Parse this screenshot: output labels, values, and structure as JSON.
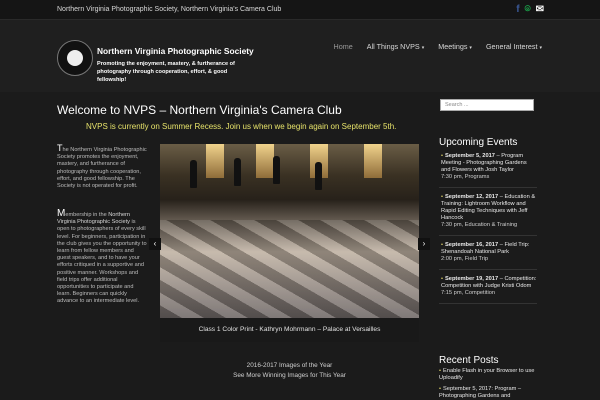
{
  "topbar": {
    "tagline": "Northern Virginia Photographic Society, Northern Virginia's Camera Club",
    "social": [
      {
        "icon": "facebook-icon",
        "symbol": "f",
        "color": "#3b5998"
      },
      {
        "icon": "location-icon",
        "symbol": "⌾",
        "color": "#1aa34a"
      },
      {
        "icon": "mail-icon",
        "symbol": "✉",
        "color": "#ffffff"
      }
    ]
  },
  "header": {
    "site_title": "Northern Virginia Photographic Society",
    "site_desc_1": "Promoting the enjoyment, mastery, & furtherance of",
    "site_desc_2": "photography through cooperation, effort, & good fellowship!",
    "nav": [
      {
        "label": "Home",
        "active": true,
        "has_caret": false
      },
      {
        "label": "All Things NVPS",
        "active": false,
        "has_caret": true
      },
      {
        "label": "Meetings",
        "active": false,
        "has_caret": true
      },
      {
        "label": "General Interest",
        "active": false,
        "has_caret": true
      }
    ]
  },
  "main": {
    "welcome": "Welcome to NVPS – Northern Virginia's Camera Club",
    "recess": "NVPS is currently on Summer Recess. Join us when we begin again on September 5th.",
    "intro_dropcap": "T",
    "intro_text": "he Northern Virginia Photographic Society promotes the enjoyment, mastery, and furtherance of photography through cooperation, effort, and good fellowship. The Society is not operated for profit.",
    "membership_dropcap": "M",
    "membership_text_1": "embership in the ",
    "membership_highlight": "Northern Virginia Photographic Society",
    "membership_text_2": " is open to photographers of every skill level. For beginners, participation in the club gives you the opportunity to learn from fellow members and guest speakers, and to have your efforts critiqued in a supportive and positive manner. Workshops and field trips offer additional opportunities to participate and learn. Beginners can quickly advance to an intermediate level.",
    "slider_caption": "Class 1 Color Print - Kathryn Mohrmann – Palace at Versailles",
    "images_link_1": "2016-2017 Images of the Year",
    "images_link_2": "See More Winning Images for This Year"
  },
  "sidebar": {
    "search_placeholder": "Search ...",
    "upcoming_title": "Upcoming Events",
    "events": [
      {
        "date": "September 5, 2017",
        "title": " – Program Meeting - Photographing Gardens and Flowers with Josh Taylor",
        "meta": "7:30 pm, Programs"
      },
      {
        "date": "September 12, 2017",
        "title": " – Education & Training: Lightroom Workflow and Rapid Editing Techniques with Jeff Hancock",
        "meta": "7:30 pm, Education & Training"
      },
      {
        "date": "September 16, 2017",
        "title": " – Field Trip: Shenandoah National Park",
        "meta": "2:00 pm, Field Trip"
      },
      {
        "date": "September 19, 2017",
        "title": " – Competition: Competition with Judge Kristi Odom",
        "meta": "7:15 pm, Competition"
      }
    ],
    "recent_title": "Recent Posts",
    "posts": [
      "Enable Flash in your Browser to use Uploadify",
      "September 5, 2017: Program – Photographing Gardens and"
    ]
  }
}
